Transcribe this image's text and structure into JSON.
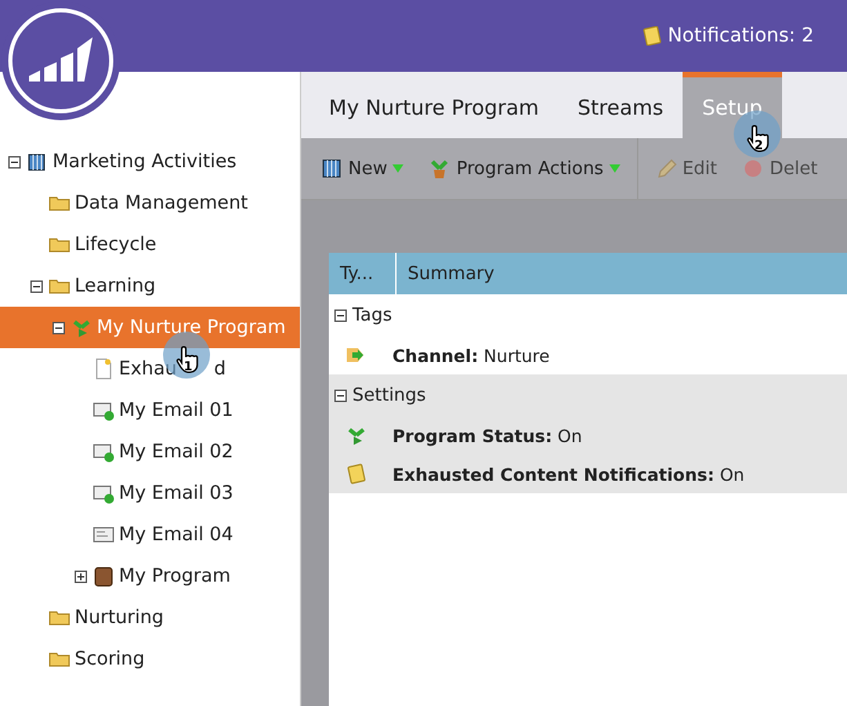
{
  "header": {
    "notifications": "Notifications: 2"
  },
  "tree": [
    {
      "label": "Marketing Activities",
      "kind": "cube",
      "expanded": true,
      "selected": false,
      "children": [
        {
          "label": "Data Management",
          "kind": "folder",
          "selected": false
        },
        {
          "label": "Lifecycle",
          "kind": "folder",
          "selected": false
        },
        {
          "label": "Learning",
          "kind": "folder",
          "expanded": true,
          "selected": false,
          "children": [
            {
              "label": "My Nurture Program",
              "kind": "sprout",
              "expanded": true,
              "selected": true,
              "children": [
                {
                  "label": "Exhau",
                  "label_end": "d",
                  "kind": "note",
                  "selected": false
                },
                {
                  "label": "My Email 01",
                  "kind": "emailok",
                  "selected": false
                },
                {
                  "label": "My Email 02",
                  "kind": "emailok",
                  "selected": false
                },
                {
                  "label": "My Email 03",
                  "kind": "emailok",
                  "selected": false
                },
                {
                  "label": "My Email 04",
                  "kind": "email",
                  "selected": false
                },
                {
                  "label": "My Program",
                  "kind": "box",
                  "expanded": false,
                  "selected": false
                }
              ]
            }
          ]
        },
        {
          "label": "Nurturing",
          "kind": "folder",
          "selected": false
        },
        {
          "label": "Scoring",
          "kind": "folder",
          "selected": false
        }
      ]
    }
  ],
  "tabs": [
    {
      "label": "My Nurture Program",
      "selected": false
    },
    {
      "label": "Streams",
      "selected": false
    },
    {
      "label": "Setup",
      "selected": true
    }
  ],
  "toolbar": [
    {
      "label": "New",
      "kind": "cube",
      "menu": true,
      "disabled": false
    },
    {
      "label": "Program Actions",
      "kind": "pot",
      "menu": true,
      "disabled": false
    },
    {
      "label": "Edit",
      "kind": "pencil",
      "menu": false,
      "disabled": true
    },
    {
      "label": "Delet",
      "kind": "delete",
      "menu": false,
      "disabled": true
    }
  ],
  "table": {
    "columns": [
      "Ty...",
      "Summary"
    ],
    "groups": [
      {
        "label": "Tags",
        "expanded": true,
        "rows": [
          {
            "kind": "tag",
            "text": "**Channel:** Nurture"
          }
        ]
      },
      {
        "label": "Settings",
        "expanded": true,
        "rows": [
          {
            "kind": "sprout",
            "text": "**Program Status:** On"
          },
          {
            "kind": "note",
            "text": "**Exhausted Content Notifications:** On"
          }
        ]
      }
    ]
  },
  "callouts": [
    {
      "number": "1"
    },
    {
      "number": "2"
    }
  ]
}
